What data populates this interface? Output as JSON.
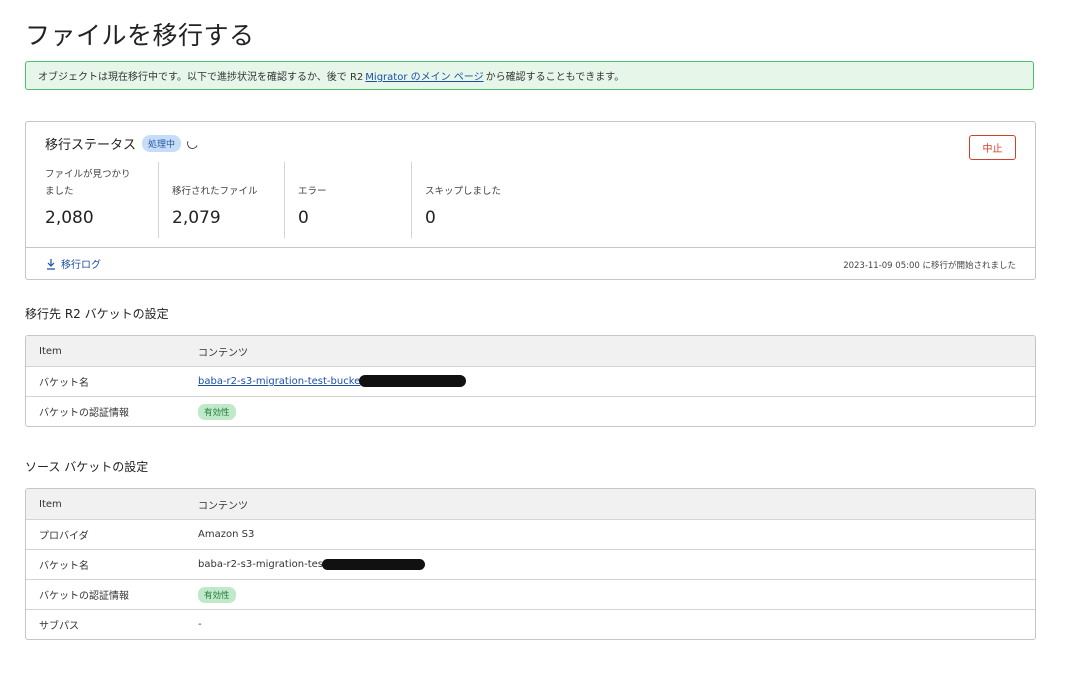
{
  "page": {
    "title": "ファイルを移行する"
  },
  "alert": {
    "text_before": "オブジェクトは現在移行中です。以下で進捗状況を確認するか、後で R2",
    "link_text": "Migrator のメイン ページ",
    "text_after": "から確認することもできます。"
  },
  "status": {
    "title": "移行ステータス",
    "badge": "処理中",
    "cancel_label": "中止",
    "stats": [
      {
        "label": "ファイルが見つかりました",
        "value": "2,080"
      },
      {
        "label": "移行されたファイル",
        "value": "2,079"
      },
      {
        "label": "エラー",
        "value": "0"
      },
      {
        "label": "スキップしました",
        "value": "0"
      }
    ],
    "log_link": "移行ログ",
    "started_text": "2023-11-09 05:00 に移行が開始されました"
  },
  "dest": {
    "heading": "移行先 R2 バケットの設定",
    "col_item": "Item",
    "col_content": "コンテンツ",
    "bucket_label": "バケット名",
    "bucket_value": "baba-r2-s3-migration-test-bucke",
    "cred_label": "バケットの認証情報",
    "cred_badge": "有効性"
  },
  "source": {
    "heading": "ソース バケットの設定",
    "col_item": "Item",
    "col_content": "コンテンツ",
    "provider_label": "プロバイダ",
    "provider_value": "Amazon S3",
    "bucket_label": "バケット名",
    "bucket_value": "baba-r2-s3-migration-tes",
    "cred_label": "バケットの認証情報",
    "cred_badge": "有効性",
    "subpath_label": "サブパス",
    "subpath_value": "-"
  }
}
